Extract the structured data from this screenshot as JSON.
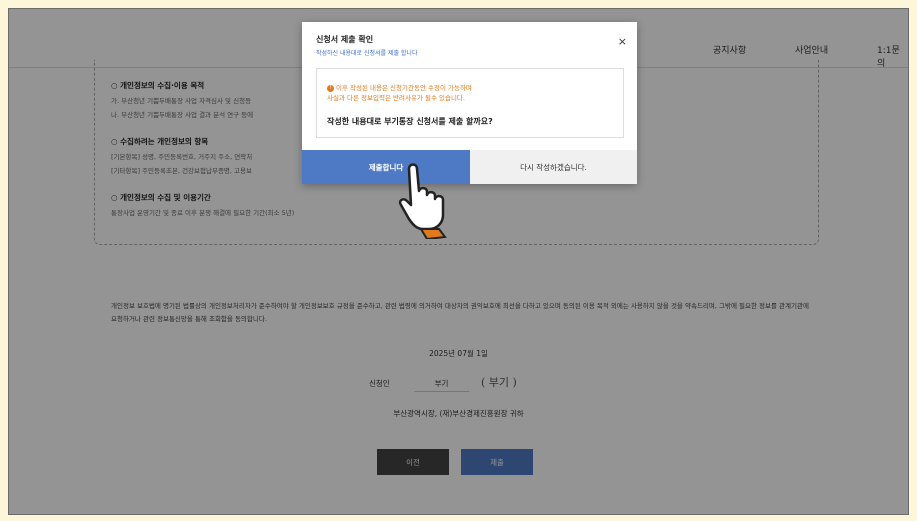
{
  "header": {
    "nav_items": [
      "공지사항",
      "사업안내",
      "1:1문의"
    ]
  },
  "background_form": {
    "sections": [
      {
        "title": "○ 개인정보의 수집·이용 목적",
        "lines": [
          "가. 부산청년 기쁨두배통장 사업 자격심사 및 신청등",
          "나. 부산청년 기쁨두배통장 사업 결과 분석 연구 등에"
        ]
      },
      {
        "title": "○ 수집하려는 개인정보의 항목",
        "lines": [
          "[기본항목] 성명, 주민등록번호, 거주지 주소, 연락처",
          "[기타항목] 주민등록초본, 건강보험납부증명, 고용보"
        ]
      },
      {
        "title": "○ 개인정보의 수집 및 이용기간",
        "lines": [
          "통장사업 운영기간 및 종료 이후 분쟁 해결에 필요한 기간(최소 5년)"
        ]
      }
    ],
    "notice": "개인정보 보호법에 명기된 법률상의 개인정보처리자가 준수하여야 할 개인정보보호 규정을 준수하고, 관련 법령에 의거하여 대상자의 권익보호에 최선을 다하고 있으며 동의된 이용 목적 외에는 사용하지 않을 것을 약속드리며, 그밖에 필요한 정보를 관계기관에 요청하거나 관련 정보통신망을 통해 조회함을 동의합니다.",
    "date": "2025년 07월 1일",
    "applicant_label": "신청인",
    "applicant_name": "부기",
    "signature": "( 부기 )",
    "addressee": "부산광역시장, (재)부산경제진흥원장 귀하",
    "prev_button": "이전",
    "submit_button": "제출"
  },
  "modal": {
    "title": "신청서 제출 확인",
    "subtitle": "작성하신 내용대로 신청서를 제출 합니다",
    "close_icon": "×",
    "warning_icon": "!",
    "warning_line1": "이후 작성된 내용은 신청기간동안 수정이 가능하며",
    "warning_line2": "사실과 다른 정보입력은 반려사유가 될수 있습니다.",
    "question": "작성한 내용대로 부기통장 신청서를 제출 할까요?",
    "confirm_button": "제출합니다",
    "cancel_button": "다시 작성하겠습니다.",
    "accent_color": "#4e79c4",
    "warning_color": "#e07a1e"
  },
  "cursor": {
    "icon": "pointing-hand-icon"
  }
}
